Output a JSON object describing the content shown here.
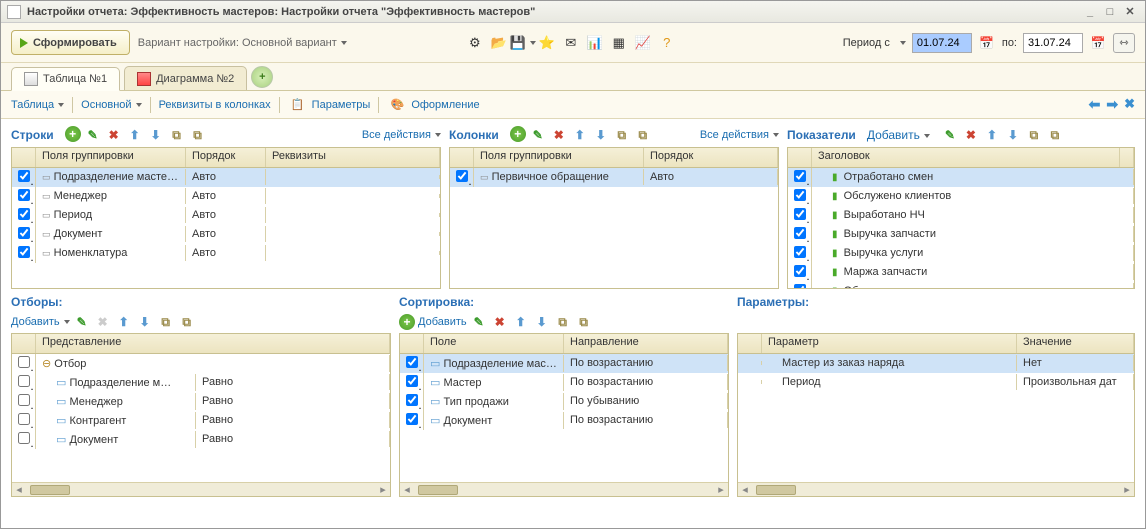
{
  "window": {
    "title": "Настройки отчета: Эффективность мастеров: Настройки отчета \"Эффективность мастеров\""
  },
  "toolbar": {
    "form_btn": "Сформировать",
    "variant_label": "Вариант настройки: Основной вариант",
    "period_from": "Период с",
    "period_to": "по:",
    "date_from": "01.07.24",
    "date_to": "31.07.24"
  },
  "tabs": {
    "t1": "Таблица №1",
    "t2": "Диаграмма №2"
  },
  "subbar": {
    "table": "Таблица",
    "main": "Основной",
    "req": "Реквизиты в колонках",
    "params": "Параметры",
    "style": "Оформление"
  },
  "panels": {
    "rows_title": "Строки",
    "cols_title": "Колонки",
    "meas_title": "Показатели",
    "all_actions": "Все действия",
    "add_dd": "Добавить"
  },
  "rows_hdr": {
    "c1": "Поля группировки",
    "c2": "Порядок",
    "c3": "Реквизиты"
  },
  "rows": [
    {
      "label": "Подразделение мастера",
      "order": "Авто",
      "sel": true
    },
    {
      "label": "Менеджер",
      "order": "Авто"
    },
    {
      "label": "Период",
      "order": "Авто"
    },
    {
      "label": "Документ",
      "order": "Авто"
    },
    {
      "label": "Номенклатура",
      "order": "Авто"
    }
  ],
  "cols_hdr": {
    "c1": "Поля группировки",
    "c2": "Порядок"
  },
  "cols": [
    {
      "label": "Первичное обращение",
      "order": "Авто",
      "sel": true
    }
  ],
  "meas_hdr": {
    "c1": "Заголовок"
  },
  "measures": [
    {
      "label": "Отработано смен",
      "sel": true
    },
    {
      "label": "Обслужено клиентов"
    },
    {
      "label": "Выработано НЧ"
    },
    {
      "label": "Выручка запчасти"
    },
    {
      "label": "Выручка услуги"
    },
    {
      "label": "Маржа запчасти"
    },
    {
      "label": "Общая выручка"
    }
  ],
  "filters_title": "Отборы:",
  "filters_hdr": {
    "c1": "Представление"
  },
  "filters_root": "Отбор",
  "filters": [
    {
      "label": "Подразделение м…",
      "op": "Равно"
    },
    {
      "label": "Менеджер",
      "op": "Равно"
    },
    {
      "label": "Контрагент",
      "op": "Равно"
    },
    {
      "label": "Документ",
      "op": "Равно"
    }
  ],
  "sort_title": "Сортировка:",
  "sort_add": "Добавить",
  "sort_hdr": {
    "c1": "Поле",
    "c2": "Направление"
  },
  "sort": [
    {
      "label": "Подразделение мас…",
      "dir": "По возрастанию",
      "sel": true
    },
    {
      "label": "Мастер",
      "dir": "По возрастанию"
    },
    {
      "label": "Тип продажи",
      "dir": "По убыванию"
    },
    {
      "label": "Документ",
      "dir": "По возрастанию"
    }
  ],
  "params_title": "Параметры:",
  "params_hdr": {
    "c1": "Параметр",
    "c2": "Значение"
  },
  "params": [
    {
      "label": "Мастер из заказ наряда",
      "val": "Нет",
      "sel": true
    },
    {
      "label": "Период",
      "val": "Произвольная дат"
    }
  ]
}
